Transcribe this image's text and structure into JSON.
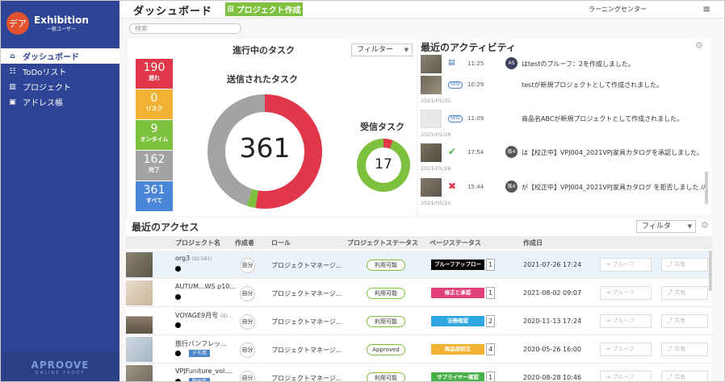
{
  "app": {
    "logo_text": "デア",
    "name": "Exhibition",
    "role": "一般ユーザー"
  },
  "sidebar": {
    "items": [
      {
        "label": "ダッシュボード",
        "icon": "home-icon",
        "active": true
      },
      {
        "label": "ToDoリスト",
        "icon": "list-icon",
        "active": false
      },
      {
        "label": "プロジェクト",
        "icon": "building-icon",
        "active": false
      },
      {
        "label": "アドレス帳",
        "icon": "address-book-icon",
        "active": false
      }
    ],
    "footer_logo": "APROOVE",
    "footer_sub": "ONLINE PROOF"
  },
  "header": {
    "title": "ダッシュボード",
    "create_button": "プロジェクト作成",
    "center_name": "ラーニングセンター"
  },
  "search": {
    "placeholder": "検索"
  },
  "tasks": {
    "title": "進行中のタスク",
    "filter": "フィルター",
    "stats": [
      {
        "value": "190",
        "label": "遅れ",
        "color": "#e0374b"
      },
      {
        "value": "0",
        "label": "リスク",
        "color": "#f2b233"
      },
      {
        "value": "9",
        "label": "オンタイム",
        "color": "#7ec13f"
      },
      {
        "value": "162",
        "label": "完了",
        "color": "#a3a3a3"
      },
      {
        "value": "361",
        "label": "すべて",
        "color": "#4a86d8"
      }
    ],
    "sent": {
      "title": "送信されたタスク",
      "total": "361",
      "segments": [
        190,
        0,
        9,
        162
      ]
    },
    "received": {
      "title": "受信タスク",
      "total": "17",
      "segments": [
        1,
        0,
        16,
        0
      ]
    }
  },
  "activity": {
    "title": "最近のアクティビティ",
    "rows": [
      {
        "time": "11:25",
        "badge": "AS",
        "text": "はtestのプルーフ：2を作成しました。",
        "icon": "document-icon",
        "date": ""
      },
      {
        "time": "10:29",
        "badge": "",
        "text": "testが新規プロジェクトとして作成されました。",
        "icon": "new-badge",
        "date": "2021/05/31"
      },
      {
        "time": "11:09",
        "badge": "",
        "text": "商品名ABCが新規プロジェクトとして作成されました。",
        "icon": "new-badge",
        "date": "2021/05/28"
      },
      {
        "time": "17:54",
        "badge": "阪4",
        "text": "は【校正中】VPJ004_2021VPJ家具カタログを承認しました。",
        "icon": "check-icon",
        "date": "2021/05/26"
      },
      {
        "time": "15:44",
        "badge": "阪4",
        "text": "が【校正中】VPJ004_2021VPJ家具カタログ を拒否しました //",
        "icon": "reject-icon",
        "date": "2021/05/21"
      }
    ],
    "new_label": "NEW"
  },
  "access": {
    "title": "最近のアクセス",
    "filter": "フィルタ",
    "columns": [
      "プロジェクト名",
      "作成者",
      "ロール",
      "プロジェクトステータス",
      "ページステータス",
      "作成日"
    ],
    "rows": [
      {
        "name": "org3",
        "id": "(ID:581)",
        "tag": "",
        "creator": "自分",
        "role": "プロジェクトマネージ...",
        "pstatus": "利用可能",
        "page_status": "プルーフアップロー",
        "page_color": "#000000",
        "page_count": "1",
        "date": "2021-07-26 17:24",
        "highlight": true
      },
      {
        "name": "AUTUM...WS p10...",
        "id": "",
        "tag": "",
        "creator": "自分",
        "role": "プロジェクトマネージ...",
        "pstatus": "利用可能",
        "page_status": "修正と承認",
        "page_color": "#e0407b",
        "page_count": "1",
        "date": "2021-08-02 09:07",
        "highlight": false
      },
      {
        "name": "VOYAGE9月号",
        "id": "(ID:...",
        "tag": "",
        "creator": "自分",
        "role": "プロジェクトマネージ...",
        "pstatus": "利用可能",
        "page_status": "法務確認",
        "page_color": "#2ea7e0",
        "page_count": "2",
        "date": "2020-11-13 17:24",
        "highlight": false
      },
      {
        "name": "旅行パンフレッ...",
        "id": "",
        "tag": "デモ用",
        "creator": "自分",
        "role": "プロジェクトマネージ...",
        "pstatus": "Approved",
        "page_status": "商品部校正",
        "page_color": "#f2b233",
        "page_count": "4",
        "date": "2020-05-26 16:00",
        "highlight": false
      },
      {
        "name": "VPJFuniture_vol....",
        "id": "",
        "tag": "動画用",
        "creator": "自分",
        "role": "プロジェクトマネージ...",
        "pstatus": "利用可能",
        "page_status": "サプライヤー確認",
        "page_color": "#4ab04a",
        "page_count": "1",
        "date": "2020-08-28 10:46",
        "highlight": false
      }
    ],
    "proof_label": "プルーフ",
    "share_label": "共有"
  }
}
